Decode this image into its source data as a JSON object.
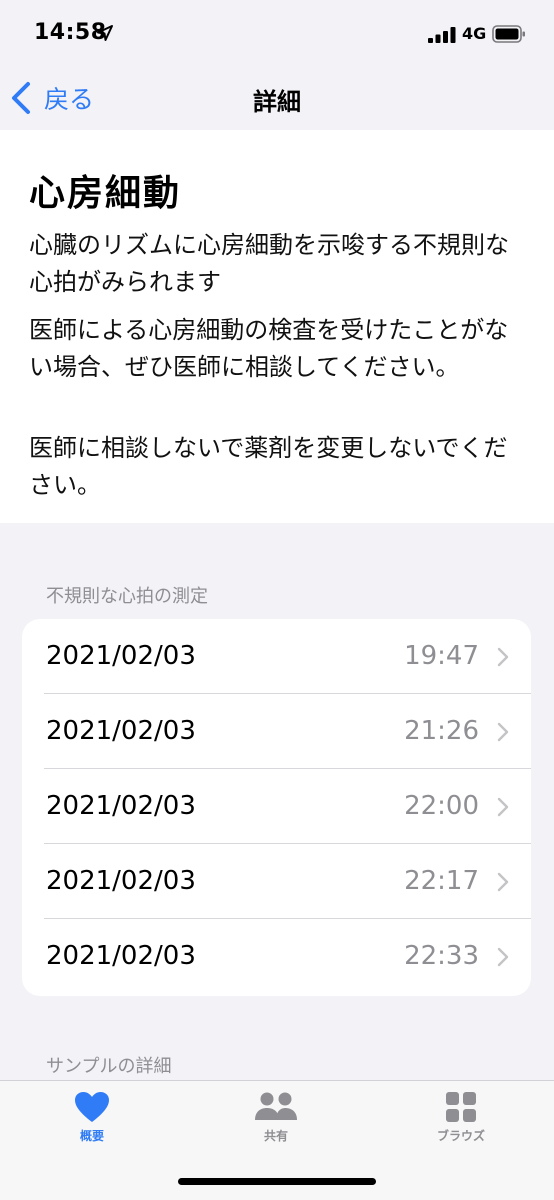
{
  "status_bar": {
    "time": "14:58",
    "network": "4G"
  },
  "nav": {
    "back_label": "戻る",
    "title": "詳細"
  },
  "info": {
    "title": "心房細動",
    "paragraphs": [
      "心臓のリズムに心房細動を示唆する不規則な心拍がみられます",
      "医師による心房細動の検査を受けたことがない場合、ぜひ医師に相談してください。",
      "医師に相談しないで薬剤を変更しないでください。"
    ]
  },
  "measurements": {
    "header": "不規則な心拍の測定",
    "rows": [
      {
        "date": "2021/02/03",
        "time": "19:47"
      },
      {
        "date": "2021/02/03",
        "time": "21:26"
      },
      {
        "date": "2021/02/03",
        "time": "22:00"
      },
      {
        "date": "2021/02/03",
        "time": "22:17"
      },
      {
        "date": "2021/02/03",
        "time": "22:33"
      }
    ]
  },
  "sample_details": {
    "header": "サンプルの詳細"
  },
  "tab_bar": {
    "items": [
      {
        "label": "概要",
        "icon": "heart-icon",
        "active": true
      },
      {
        "label": "共有",
        "icon": "people-icon",
        "active": false
      },
      {
        "label": "ブラウズ",
        "icon": "grid-icon",
        "active": false
      }
    ]
  },
  "colors": {
    "accent": "#2f7cf6",
    "secondary_text": "#8e8e93",
    "inactive_tab": "#8e8e93",
    "background": "#f2f2f7"
  }
}
